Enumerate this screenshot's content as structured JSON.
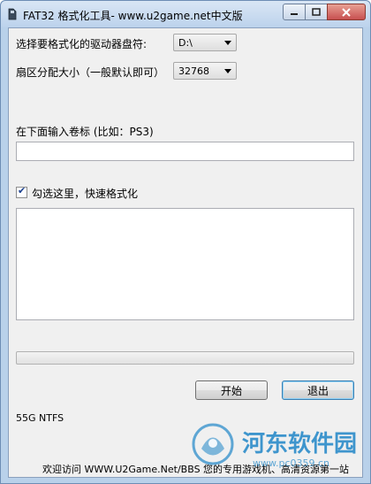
{
  "window": {
    "title": "FAT32 格式化工具- www.u2game.net中文版"
  },
  "form": {
    "drive_label": "选择要格式化的驱动器盘符:",
    "drive_value": "D:\\",
    "cluster_label": "扇区分配大小（一般默认即可）",
    "cluster_value": "32768",
    "volume_label": "在下面输入卷标 (比如：PS3)",
    "volume_value": "",
    "quick_format_label": "勾选这里，快速格式化",
    "quick_format_checked": true,
    "log_text": "",
    "progress_fraction": 0.0
  },
  "buttons": {
    "start_label": "开始",
    "exit_label": "退出"
  },
  "status": {
    "disk_info": "55G NTFS",
    "footer": "欢迎访问 WWW.U2Game.Net/BBS 您的专用游戏机、高清资源第一站"
  },
  "watermark": {
    "text": "河东软件园",
    "url": "www.pc0359.cn"
  },
  "colors": {
    "accent": "#1f86c8",
    "progress": "#06b025"
  }
}
